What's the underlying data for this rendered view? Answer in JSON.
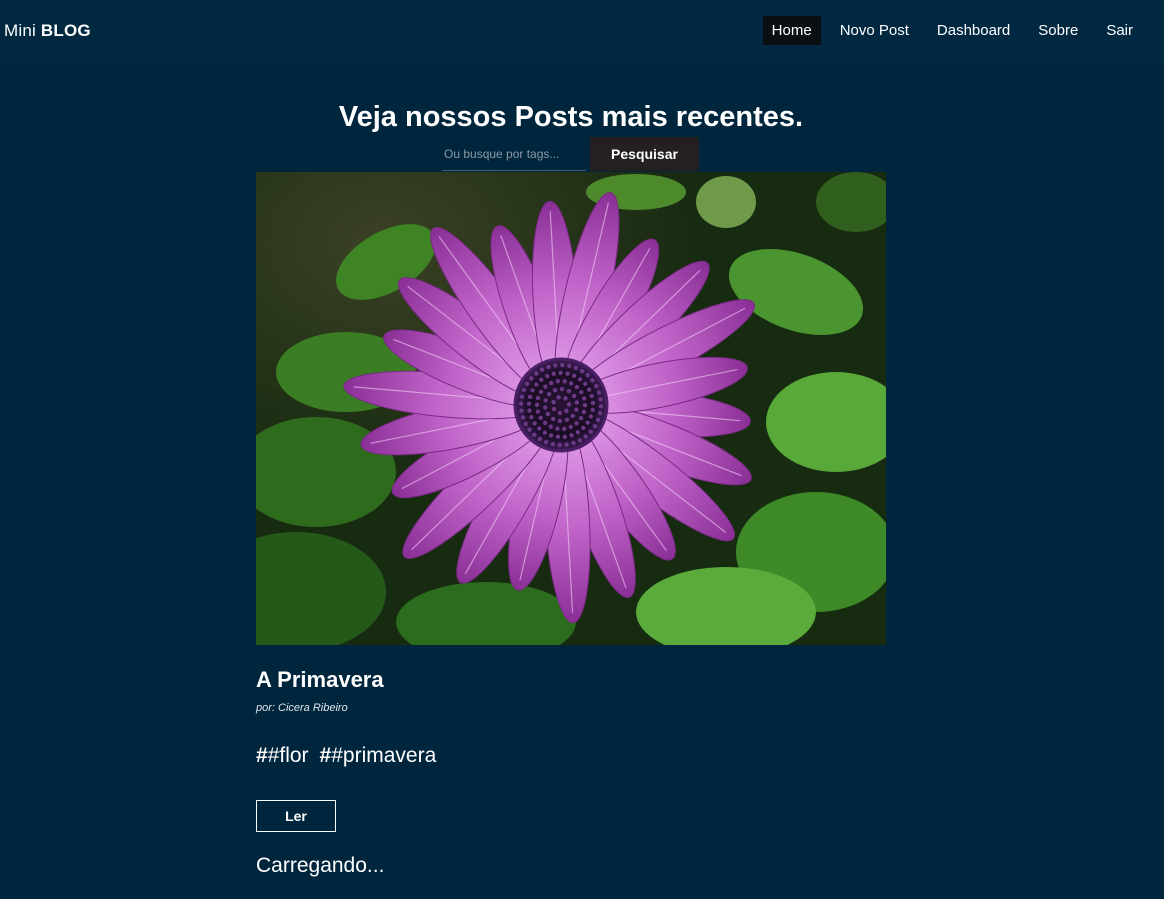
{
  "brand": {
    "prefix": "Mini",
    "strong": "BLOG"
  },
  "nav": {
    "items": [
      {
        "label": "Home",
        "active": true
      },
      {
        "label": "Novo Post",
        "active": false
      },
      {
        "label": "Dashboard",
        "active": false
      },
      {
        "label": "Sobre",
        "active": false
      },
      {
        "label": "Sair",
        "active": false
      }
    ]
  },
  "hero": {
    "title": "Veja nossos Posts mais recentes."
  },
  "search": {
    "placeholder": "Ou busque por tags...",
    "button_label": "Pesquisar"
  },
  "post": {
    "image_icon": "purple-daisy-photo",
    "title": "A Primavera",
    "author": "por: Cicera Ribeiro",
    "tags": [
      {
        "hash": "#",
        "text": "#flor"
      },
      {
        "hash": "#",
        "text": "#primavera"
      }
    ],
    "read_label": "Ler"
  },
  "status": {
    "loading": "Carregando..."
  },
  "colors": {
    "background": "#00263e",
    "active_nav": "#0a0f14",
    "search_button": "#24201f",
    "petal": "#c066c8"
  }
}
